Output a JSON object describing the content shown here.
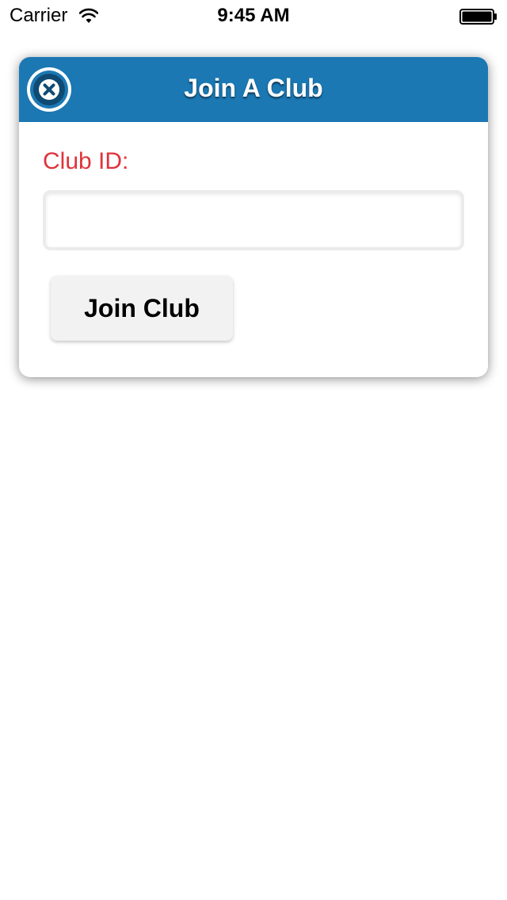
{
  "status_bar": {
    "carrier": "Carrier",
    "time": "9:45 AM",
    "wifi_icon": "wifi-icon",
    "battery_icon": "battery-full-icon"
  },
  "dialog": {
    "title": "Join A Club",
    "close_icon": "close-icon",
    "field_label": "Club ID:",
    "club_id_value": "",
    "club_id_placeholder": "",
    "submit_label": "Join Club"
  },
  "colors": {
    "header_blue": "#1b78b3",
    "label_red": "#e0333a",
    "button_gray": "#f2f2f2"
  }
}
